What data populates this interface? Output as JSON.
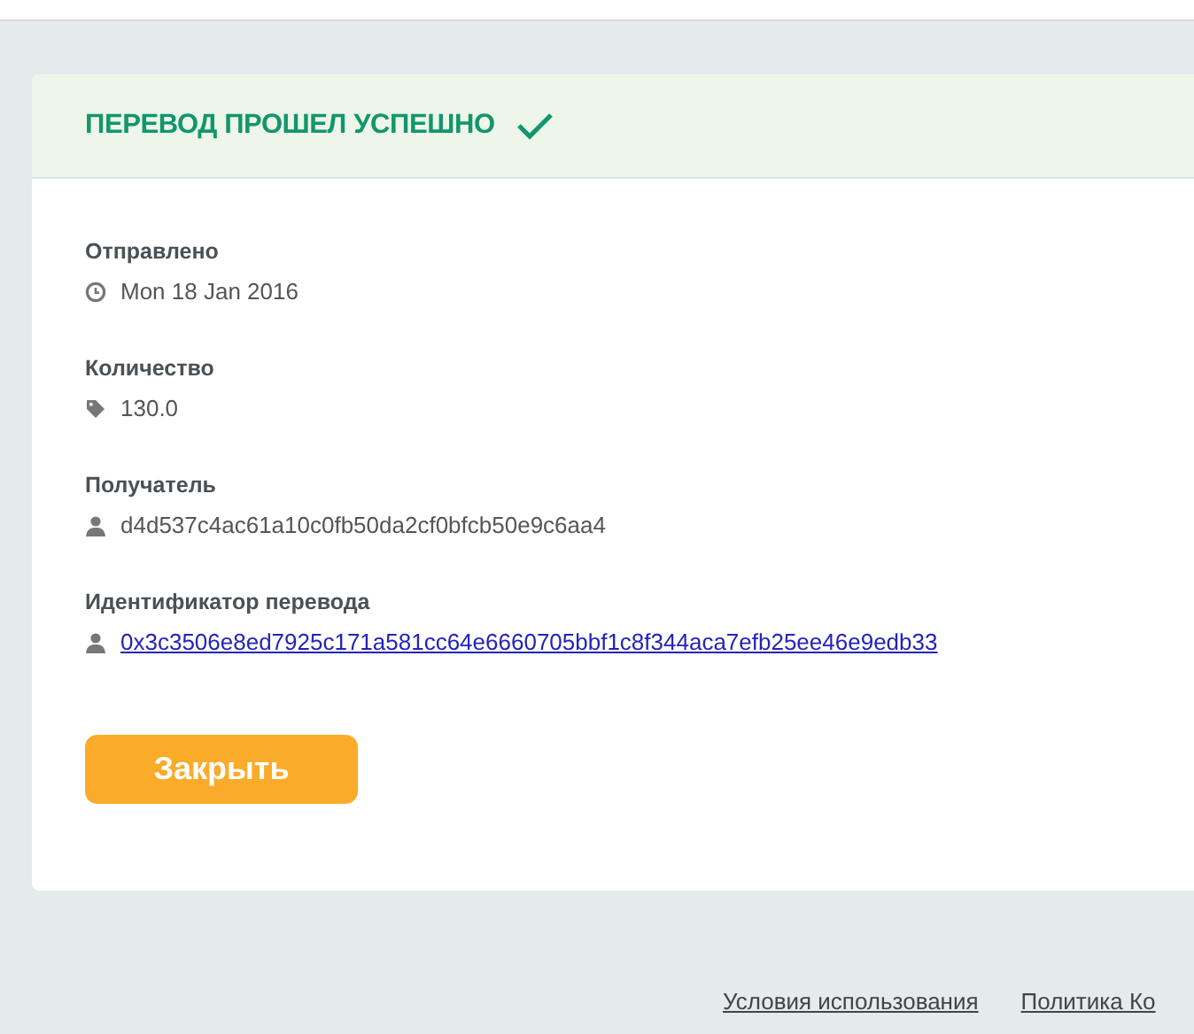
{
  "header": {
    "title": "ПЕРЕВОД ПРОШЕЛ УСПЕШНО"
  },
  "fields": [
    {
      "kind": "date",
      "label": "Отправлено",
      "value": "Mon 18 Jan 2016"
    },
    {
      "kind": "amount",
      "label": "Количество",
      "value": "130.0"
    },
    {
      "kind": "address",
      "label": "Получатель",
      "value": "d4d537c4ac61a10c0fb50da2cf0bfcb50e9c6aa4"
    },
    {
      "kind": "transaction",
      "label": "Идентификатор перевода",
      "value": "0x3c3506e8ed7925c171a581cc64e6660705bbf1c8f344aca7efb25ee46e9edb33"
    }
  ],
  "button": {
    "label": "Закрыть"
  },
  "footer_links": [
    "Условия использования",
    "Политика Ко"
  ]
}
